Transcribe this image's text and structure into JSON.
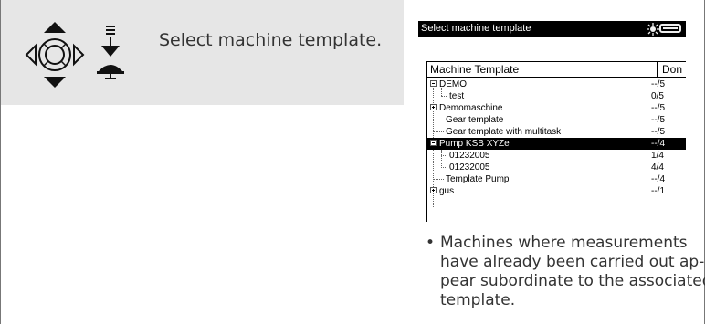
{
  "instruction": {
    "text": "Select machine template.",
    "nav_icon": "navigation-wheel-icon",
    "press_icon": "press-down-icon"
  },
  "screen": {
    "title": "Select machine template",
    "status_icon": "sun-status-icon",
    "battery_icon": "battery-icon",
    "columns": [
      "Machine Template",
      "Don"
    ],
    "rows": [
      {
        "name": "DEMO",
        "value": "--/5",
        "level": 0,
        "expander": "minus",
        "selected": false
      },
      {
        "name": "test",
        "value": "0/5",
        "level": 1,
        "expander": "",
        "selected": false
      },
      {
        "name": "Demomaschine",
        "value": "--/5",
        "level": 0,
        "expander": "plus",
        "selected": false
      },
      {
        "name": "Gear template",
        "value": "--/5",
        "level": 0,
        "expander": "",
        "selected": false
      },
      {
        "name": "Gear template with multitask",
        "value": "--/5",
        "level": 0,
        "expander": "",
        "selected": false
      },
      {
        "name": "Pump KSB XYZe",
        "value": "--/4",
        "level": 0,
        "expander": "minus",
        "selected": true
      },
      {
        "name": "01232005",
        "value": "1/4",
        "level": 1,
        "expander": "",
        "selected": false
      },
      {
        "name": "01232005",
        "value": "4/4",
        "level": 1,
        "expander": "",
        "selected": false
      },
      {
        "name": "Template Pump",
        "value": "--/4",
        "level": 0,
        "expander": "",
        "selected": false
      },
      {
        "name": "gus",
        "value": "--/1",
        "level": 0,
        "expander": "plus",
        "selected": false
      }
    ]
  },
  "note": {
    "bullet": "•",
    "lines": [
      "Machines where measurements",
      "have already been carried out ap-",
      "pear subordinate to the associated",
      "template."
    ]
  }
}
